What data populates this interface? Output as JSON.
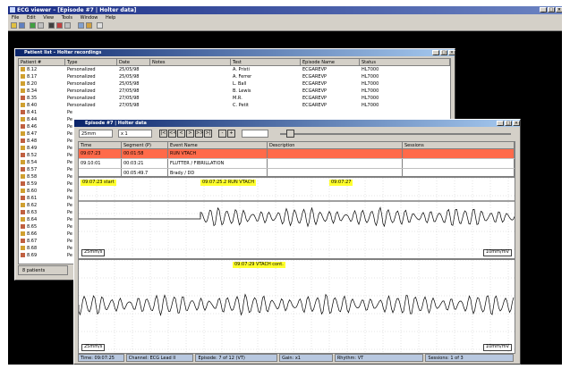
{
  "app": {
    "title": "ECG viewer – [Episode #7 | Holter data]",
    "menu": [
      "File",
      "Edit",
      "View",
      "Tools",
      "Window",
      "Help"
    ],
    "window_buttons": [
      "_",
      "□",
      "×"
    ],
    "client_bg": "#000000",
    "titlebar_color": "#1a2d86"
  },
  "patients": {
    "title": "Patient list – Holter recordings",
    "columns": [
      "Patient #",
      "Type",
      "Date",
      "Notes",
      "Test",
      "Episode Name",
      "Status"
    ],
    "rows": [
      {
        "id": "8.12",
        "type": "Personalized",
        "date": "25/05/98",
        "notes": "",
        "test": "A. Pristi",
        "episode": "ECGAREVP",
        "status": "HL7000",
        "icon": "#d0a030"
      },
      {
        "id": "8.17",
        "type": "Personalized",
        "date": "25/05/98",
        "notes": "",
        "test": "A. Ferrer",
        "episode": "ECGAREVP",
        "status": "HL7000",
        "icon": "#d0a030"
      },
      {
        "id": "8.20",
        "type": "Personalized",
        "date": "25/05/98",
        "notes": "",
        "test": "L. Ball",
        "episode": "ECGAREVP",
        "status": "HL7000",
        "icon": "#d0a030"
      },
      {
        "id": "8.34",
        "type": "Personalized",
        "date": "27/05/98",
        "notes": "",
        "test": "B. Lewis",
        "episode": "ECGAREVP",
        "status": "HL7000",
        "icon": "#d0a030"
      },
      {
        "id": "8.35",
        "type": "Personalized",
        "date": "27/05/98",
        "notes": "",
        "test": "M.R.",
        "episode": "ECGAREVP",
        "status": "HL7000",
        "icon": "#c06040"
      },
      {
        "id": "8.40",
        "type": "Personalized",
        "date": "27/05/98",
        "notes": "",
        "test": "C. Petit",
        "episode": "ECGAREVP",
        "status": "HL7000",
        "icon": "#d0a030"
      },
      {
        "id": "8.41",
        "type": "Pe",
        "date": "",
        "notes": "",
        "test": "",
        "episode": "",
        "status": "",
        "icon": "#c06040"
      },
      {
        "id": "8.44",
        "type": "Pe",
        "date": "",
        "notes": "",
        "test": "",
        "episode": "",
        "status": "",
        "icon": "#d0a030"
      },
      {
        "id": "8.46",
        "type": "Pe",
        "date": "",
        "notes": "",
        "test": "",
        "episode": "",
        "status": "",
        "icon": "#c06040"
      },
      {
        "id": "8.47",
        "type": "Pe",
        "date": "",
        "notes": "",
        "test": "",
        "episode": "",
        "status": "",
        "icon": "#d0a030"
      },
      {
        "id": "8.48",
        "type": "Pe",
        "date": "",
        "notes": "",
        "test": "",
        "episode": "",
        "status": "",
        "icon": "#c06040"
      },
      {
        "id": "8.49",
        "type": "Pe",
        "date": "",
        "notes": "",
        "test": "",
        "episode": "",
        "status": "",
        "icon": "#d0a030"
      },
      {
        "id": "8.52",
        "type": "Pe",
        "date": "",
        "notes": "",
        "test": "",
        "episode": "",
        "status": "",
        "icon": "#c06040"
      },
      {
        "id": "8.54",
        "type": "Pe",
        "date": "",
        "notes": "",
        "test": "",
        "episode": "",
        "status": "",
        "icon": "#d0a030"
      },
      {
        "id": "8.57",
        "type": "Pe",
        "date": "",
        "notes": "",
        "test": "",
        "episode": "",
        "status": "",
        "icon": "#c06040"
      },
      {
        "id": "8.58",
        "type": "Pe",
        "date": "",
        "notes": "",
        "test": "",
        "episode": "",
        "status": "",
        "icon": "#d0a030"
      },
      {
        "id": "8.59",
        "type": "Pe",
        "date": "",
        "notes": "",
        "test": "",
        "episode": "",
        "status": "",
        "icon": "#c06040"
      },
      {
        "id": "8.60",
        "type": "Pe",
        "date": "",
        "notes": "",
        "test": "",
        "episode": "",
        "status": "",
        "icon": "#d0a030"
      },
      {
        "id": "8.61",
        "type": "Pe",
        "date": "",
        "notes": "",
        "test": "",
        "episode": "",
        "status": "",
        "icon": "#c06040"
      },
      {
        "id": "8.62",
        "type": "Pe",
        "date": "",
        "notes": "",
        "test": "",
        "episode": "",
        "status": "",
        "icon": "#d0a030"
      },
      {
        "id": "8.63",
        "type": "Pe",
        "date": "",
        "notes": "",
        "test": "",
        "episode": "",
        "status": "",
        "icon": "#c06040"
      },
      {
        "id": "8.64",
        "type": "Pe",
        "date": "",
        "notes": "",
        "test": "",
        "episode": "",
        "status": "",
        "icon": "#d0a030"
      },
      {
        "id": "8.65",
        "type": "Pe",
        "date": "",
        "notes": "",
        "test": "",
        "episode": "",
        "status": "",
        "icon": "#c06040"
      },
      {
        "id": "8.66",
        "type": "Pe",
        "date": "",
        "notes": "",
        "test": "",
        "episode": "",
        "status": "",
        "icon": "#d0a030"
      },
      {
        "id": "8.67",
        "type": "Pe",
        "date": "",
        "notes": "",
        "test": "",
        "episode": "",
        "status": "",
        "icon": "#c06040"
      },
      {
        "id": "8.68",
        "type": "Pe",
        "date": "",
        "notes": "",
        "test": "",
        "episode": "",
        "status": "",
        "icon": "#d0a030"
      },
      {
        "id": "8.69",
        "type": "Pe",
        "date": "",
        "notes": "",
        "test": "",
        "episode": "",
        "status": "",
        "icon": "#c06040"
      }
    ],
    "status_text": "8 patients"
  },
  "episode": {
    "title": "Episode #7 | Holter data",
    "speed_select": "25mm",
    "gain_select": "x 1",
    "nav_buttons": [
      "|<",
      "<<",
      "<",
      ">",
      ">>",
      ">|"
    ],
    "zoom_buttons": [
      "-",
      "+"
    ],
    "columns": [
      "Time",
      "Segment (P)",
      "Event Name",
      "Description",
      "Sessions"
    ],
    "rows": [
      {
        "time": "09:07:23",
        "segment": "00:01:58",
        "event": "RUN VTACH",
        "desc": "",
        "sessions": "",
        "selected": true
      },
      {
        "time": "09:10:01",
        "segment": "00:03:21",
        "event": "FLUTTER / FIBRILLATION",
        "desc": "",
        "sessions": "",
        "selected": false
      },
      {
        "time": "",
        "segment": "00:05:49.7",
        "event": "Brady / DD",
        "desc": "",
        "sessions": "",
        "selected": false
      }
    ],
    "selected_row_color": "#ff6a4a",
    "strip1": {
      "tags": [
        "09:07:23 start",
        "09:07:25.2 RUN VTACH",
        "09:07:27"
      ],
      "scale_left": "25mm/s",
      "scale_right": "10mm/mV"
    },
    "strip2": {
      "tags": [
        "09:07:29 VTACH cont."
      ],
      "scale_left": "25mm/s",
      "scale_right": "10mm/mV"
    },
    "tag_color": "#ffff2e",
    "status": [
      "Time: 09:07:25",
      "Channel: ECG Lead II",
      "Episode: 7 of 12 (VT)",
      "Gain: x1",
      "Rhythm: VT",
      "Sessions: 1 of 3"
    ]
  }
}
